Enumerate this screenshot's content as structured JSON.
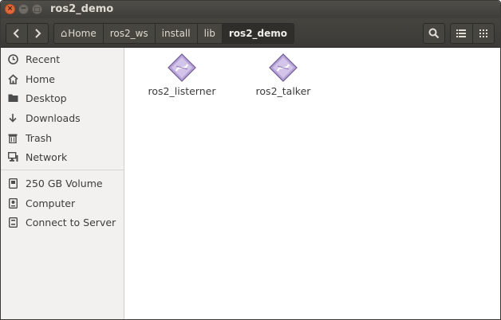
{
  "window": {
    "title": "ros2_demo"
  },
  "titlebar": {
    "close_icon": "×",
    "minimize_icon": "−",
    "maximize_icon": "□"
  },
  "nav": {
    "back_icon": "‹",
    "forward_icon": "›"
  },
  "pathbar": {
    "home_glyph": "⌂",
    "crumbs": [
      "Home",
      "ros2_ws",
      "install",
      "lib",
      "ros2_demo"
    ]
  },
  "sidebar": {
    "places": [
      {
        "label": "Recent",
        "icon": "clock-icon"
      },
      {
        "label": "Home",
        "icon": "home-icon"
      },
      {
        "label": "Desktop",
        "icon": "folder-icon"
      },
      {
        "label": "Downloads",
        "icon": "download-icon"
      },
      {
        "label": "Trash",
        "icon": "trash-icon"
      },
      {
        "label": "Network",
        "icon": "network-icon"
      }
    ],
    "devices": [
      {
        "label": "250 GB Volume",
        "icon": "drive-icon"
      },
      {
        "label": "Computer",
        "icon": "computer-icon"
      },
      {
        "label": "Connect to Server",
        "icon": "server-icon"
      }
    ]
  },
  "files": [
    {
      "name": "ros2_listerner",
      "icon": "executable-icon"
    },
    {
      "name": "ros2_talker",
      "icon": "executable-icon"
    }
  ],
  "colors": {
    "titlebar": "#3e3d39",
    "close_button": "#e5683c",
    "sidebar_bg": "#f2f1f0",
    "content_bg": "#ffffff",
    "exec_icon": "#b49fd4"
  }
}
